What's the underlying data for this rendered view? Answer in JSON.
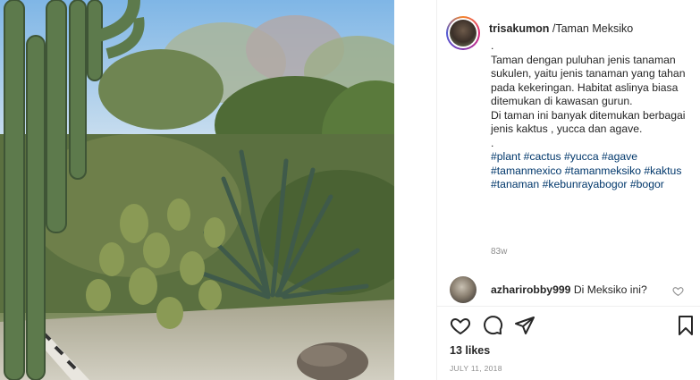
{
  "post": {
    "username": "trisakumon",
    "location": "Taman Meksiko",
    "location_separator": " /",
    "caption": {
      "dot1": ".",
      "para1": "Taman dengan puluhan jenis tanaman sukulen, yaitu jenis tanaman yang tahan pada kekeringan. Habitat aslinya biasa ditemukan di kawasan gurun.",
      "para2": "Di taman ini banyak ditemukan berbagai jenis kaktus , yucca dan agave.",
      "dot2": ".",
      "hashtags": [
        "#plant",
        "#cactus",
        "#yucca",
        "#agave",
        "#tamanmexico",
        "#tamanmeksiko",
        "#kaktus",
        "#tanaman",
        "#kebunrayabogor",
        "#bogor"
      ]
    },
    "time_ago": "83w",
    "comment": {
      "username": "azharirobby999",
      "text": "Di Meksiko ini?"
    },
    "likes": "13 likes",
    "date": "JULY 11, 2018"
  },
  "icons": {
    "like": "heart-icon",
    "comment": "comment-bubble-icon",
    "share": "paper-plane-icon",
    "save": "bookmark-icon",
    "comment_like": "heart-outline-icon"
  },
  "colors": {
    "text": "#262626",
    "hashtag": "#00376b",
    "muted": "#8e8e8e",
    "divider": "#efefef"
  }
}
